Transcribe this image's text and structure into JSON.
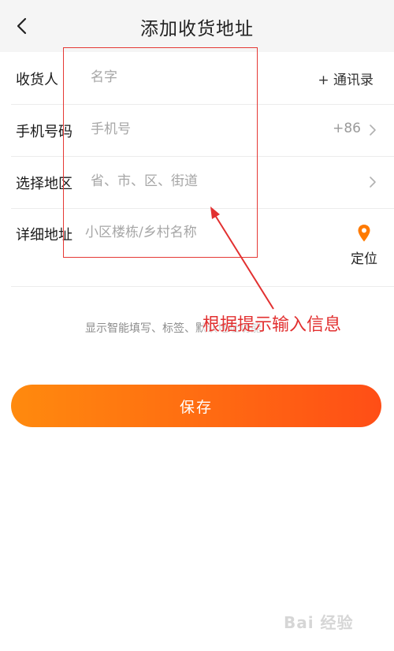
{
  "header": {
    "title": "添加收货地址"
  },
  "form": {
    "name": {
      "label": "收货人",
      "placeholder": "名字",
      "contact_link": "+ 通讯录"
    },
    "phone": {
      "label": "手机号码",
      "placeholder": "手机号",
      "country_code": "+86"
    },
    "region": {
      "label": "选择地区",
      "placeholder": "省、市、区、街道"
    },
    "address": {
      "label": "详细地址",
      "placeholder": "小区楼栋/乡村名称",
      "locate_label": "定位"
    }
  },
  "hint": "显示智能填写、标签、默认地址功能",
  "save_label": "保存",
  "annotation": "根据提示输入信息",
  "watermark": "Bai 经验",
  "colors": {
    "accent_start": "#ff8a0e",
    "accent_end": "#ff4e16",
    "annotation_red": "#e23030",
    "locate_pin": "#ff7a00"
  },
  "icons": [
    "chevron-left-icon",
    "chevron-right-icon",
    "location-pin-icon"
  ]
}
